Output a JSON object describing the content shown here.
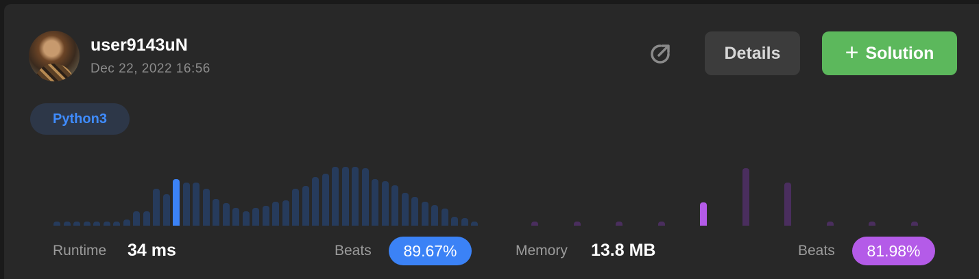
{
  "header": {
    "username": "user9143uN",
    "timestamp": "Dec 22, 2022 16:56",
    "details_label": "Details",
    "solution_label": "Solution"
  },
  "language": "Python3",
  "runtime": {
    "label": "Runtime",
    "value": "34 ms",
    "beats_label": "Beats",
    "beats_value": "89.67%",
    "color": "#3b82f6",
    "bar_color": "#263b5c",
    "distribution": [
      0.07,
      0.07,
      0.07,
      0.07,
      0.07,
      0.07,
      0.07,
      0.1,
      0.25,
      0.25,
      0.63,
      0.53,
      0.79,
      0.73,
      0.73,
      0.63,
      0.45,
      0.38,
      0.3,
      0.25,
      0.3,
      0.34,
      0.41,
      0.43,
      0.63,
      0.67,
      0.83,
      0.88,
      1.0,
      1.0,
      1.0,
      0.98,
      0.79,
      0.76,
      0.69,
      0.56,
      0.49,
      0.41,
      0.35,
      0.29,
      0.15,
      0.13,
      0.07
    ],
    "highlight_index": 12
  },
  "memory": {
    "label": "Memory",
    "value": "13.8 MB",
    "beats_label": "Beats",
    "beats_value": "81.98%",
    "color": "#b45be8",
    "bar_color": "#4a2e5e",
    "distribution": [
      0.07,
      0.07,
      0.07,
      0.07,
      0.4,
      0.98,
      0.73,
      0.07,
      0.07,
      0.07
    ],
    "highlight_index": 4
  }
}
